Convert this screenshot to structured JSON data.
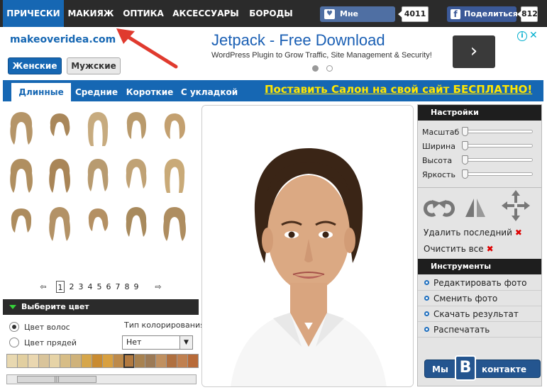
{
  "topnav": {
    "tabs": [
      "ПРИЧЕСКИ",
      "МАКИЯЖ",
      "ОПТИКА",
      "АКСЕССУАРЫ",
      "БОРОДЫ"
    ],
    "like_label": "Мне нравится",
    "like_count": "4011",
    "share_label": "Поделиться",
    "share_count": "812"
  },
  "header": {
    "site_name": "makeoveridea.com",
    "gender": [
      "Женские",
      "Мужские"
    ]
  },
  "ad": {
    "title": "Jetpack - Free Download",
    "description": "WordPress Plugin to Grow Traffic, Site Management & Security!",
    "next": "›",
    "info": "i",
    "close": "✕"
  },
  "length_tabs": [
    "Длинные",
    "Средние",
    "Короткие",
    "С укладкой"
  ],
  "promo": "Поставить Салон на свой сайт БЕСПЛАТНО!",
  "pager": {
    "prev": "⇦",
    "next": "⇨",
    "pages": [
      "1",
      "2",
      "3",
      "4",
      "5",
      "6",
      "7",
      "8",
      "9"
    ]
  },
  "color_section": {
    "title": "Выберите цвет",
    "hair_color": "Цвет волос",
    "strand_color": "Цвет прядей",
    "coloring_type_label": "Тип колорирования",
    "coloring_type_value": "Нет",
    "dropdown": "▼",
    "swatches": [
      "#e8d8b0",
      "#e2cfa0",
      "#ead7b0",
      "#d9c49a",
      "#e6d3a6",
      "#d7bd86",
      "#cfb27a",
      "#d6a64a",
      "#c98b30",
      "#d8a040",
      "#bd8a4a",
      "#b27a40",
      "#a88250",
      "#9c7a56",
      "#c09060",
      "#b07040",
      "#c08050",
      "#b86a38"
    ],
    "scroll_grip": "|||"
  },
  "settings": {
    "title": "Настройки",
    "sliders": [
      "Масштаб",
      "Ширина",
      "Высота",
      "Яркость"
    ],
    "delete_last": "Удалить последний",
    "clear_all": "Очистить все",
    "x": "✖"
  },
  "tools": {
    "title": "Инструменты",
    "actions": [
      "Редактировать фото",
      "Сменить фото",
      "Скачать результат",
      "Распечатать"
    ]
  },
  "vk": {
    "left": "Мы",
    "logo": "B",
    "right": "контакте"
  }
}
